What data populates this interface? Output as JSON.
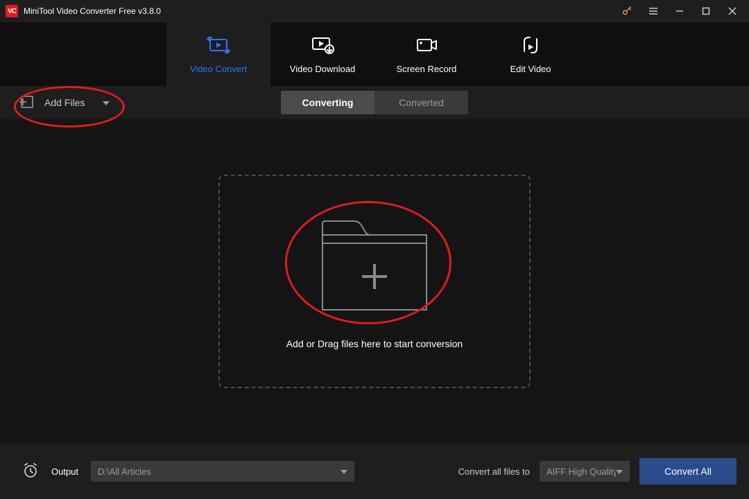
{
  "titlebar": {
    "logo_text": "VC",
    "title": "MiniTool Video Converter Free v3.8.0"
  },
  "tabs": [
    {
      "id": "video-convert",
      "label": "Video Convert",
      "active": true
    },
    {
      "id": "video-download",
      "label": "Video Download",
      "active": false
    },
    {
      "id": "screen-record",
      "label": "Screen Record",
      "active": false
    },
    {
      "id": "edit-video",
      "label": "Edit Video",
      "active": false
    }
  ],
  "actionbar": {
    "add_files_label": "Add Files",
    "segments": [
      {
        "id": "converting",
        "label": "Converting",
        "active": true
      },
      {
        "id": "converted",
        "label": "Converted",
        "active": false
      }
    ]
  },
  "dropzone": {
    "hint": "Add or Drag files here to start conversion"
  },
  "footer": {
    "output_label": "Output",
    "output_path": "D:\\All Articles",
    "convert_all_label": "Convert all files to",
    "convert_target": "AIFF High Quality",
    "convert_all_button": "Convert All"
  }
}
